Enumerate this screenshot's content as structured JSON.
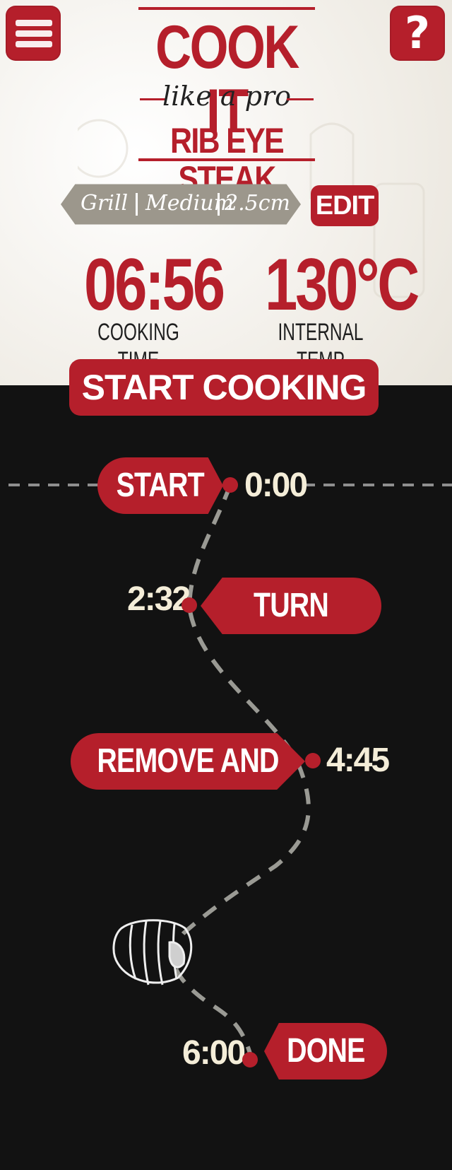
{
  "header": {
    "logo": {
      "line1": "COOK IT",
      "line2": "like a pro",
      "line3": "RIB EYE STEAK"
    },
    "menu_icon": "hamburger-menu-icon",
    "help_icon": "question-mark-icon",
    "help_label": "?"
  },
  "settings": {
    "method": "Grill",
    "doneness": "Medium",
    "thickness": "2.5cm",
    "edit_label": "EDIT"
  },
  "stats": {
    "cooking_time": "06:56",
    "cooking_time_label": "COOKING TIME",
    "internal_temp": "130°C",
    "internal_temp_label": "INTERNAL TEMP"
  },
  "actions": {
    "start_cooking_label": "START COOKING"
  },
  "timeline": {
    "steps": [
      {
        "label": "START",
        "time": "0:00"
      },
      {
        "label": "TURN STEAK",
        "time": "2:32"
      },
      {
        "label": "REMOVE AND REST",
        "time": "4:45"
      },
      {
        "label": "DONE",
        "time": "6:00"
      }
    ],
    "illustration_icon": "steak-icon"
  },
  "colors": {
    "accent_red": "#b51f2b",
    "banner_gray": "#9c978c",
    "dark_bg": "#121212",
    "cream_text": "#f4edd8"
  }
}
